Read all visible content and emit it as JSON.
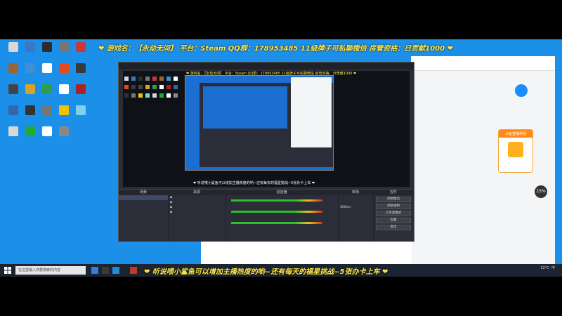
{
  "top_banner": "❤ 游戏名：【永劫无间】 平台：Steam QQ群：178953485 11级牌子可私聊微信 房管资格：日贡献1000 ❤",
  "bottom_caption": "❤ 听说喂小鲨鱼可以增加主播热度的哟~还有每天的福星挑战~5张办卡上车 ❤",
  "desktop_icons": [
    {
      "label": "",
      "color": "#d8d8d8"
    },
    {
      "label": "",
      "color": "#3a77c9"
    },
    {
      "label": "",
      "color": "#2d2d2d"
    },
    {
      "label": "",
      "color": "#777777"
    },
    {
      "label": "",
      "color": "#c83a3a"
    },
    {
      "label": "",
      "color": "#996633"
    },
    {
      "label": "",
      "color": "#3d8fd6"
    },
    {
      "label": "",
      "color": "#ffffff"
    },
    {
      "label": "",
      "color": "#e24a1c"
    },
    {
      "label": "",
      "color": "#3a3a3a"
    },
    {
      "label": "",
      "color": "#444444"
    },
    {
      "label": "",
      "color": "#d9a323"
    },
    {
      "label": "",
      "color": "#2aa04a"
    },
    {
      "label": "",
      "color": "#ffffff"
    },
    {
      "label": "",
      "color": "#b02020"
    },
    {
      "label": "",
      "color": "#3366aa"
    },
    {
      "label": "",
      "color": "#333333"
    },
    {
      "label": "",
      "color": "#777777"
    },
    {
      "label": "",
      "color": "#f2c200"
    },
    {
      "label": "",
      "color": "#7dd3e8"
    },
    {
      "label": "",
      "color": "#d8d8d8"
    },
    {
      "label": "",
      "color": "#22aa33"
    },
    {
      "label": "",
      "color": "#ffffff"
    },
    {
      "label": "",
      "color": "#888888"
    }
  ],
  "right_app": {
    "promo_title": "斗鱼直播伴侣",
    "badge": "15%"
  },
  "obs": {
    "docks": {
      "scenes_header": "场景",
      "sources_header": "来源",
      "mixer_header": "混音器",
      "transitions_header": "转场",
      "controls_header": "控件",
      "transition_duration": "300ms",
      "controls": [
        "开始推流",
        "开始录制",
        "工作室模式",
        "设置",
        "退出"
      ]
    }
  },
  "taskbar": {
    "search_placeholder": "在这里输入你要搜索的内容",
    "temp": "32°C",
    "tray_text": "中"
  }
}
